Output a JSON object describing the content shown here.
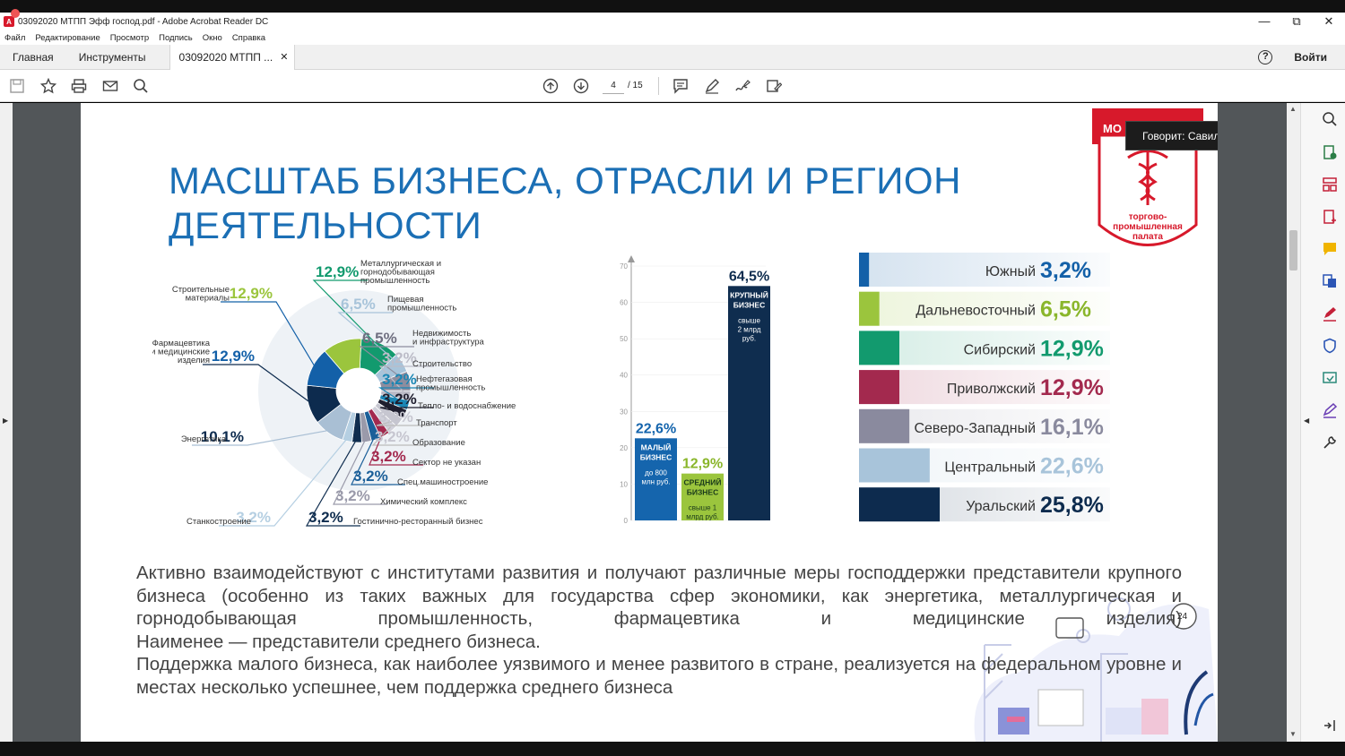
{
  "window": {
    "title": "03092020 МТПП Эфф господ.pdf - Adobe Acrobat Reader DC"
  },
  "menu": [
    "Файл",
    "Редактирование",
    "Просмотр",
    "Подпись",
    "Окно",
    "Справка"
  ],
  "tabs": {
    "home": "Главная",
    "tools": "Инструменты",
    "document": "03092020 МТПП ...",
    "login": "Войти"
  },
  "toolbar": {
    "current_page": "4",
    "total_pages": "/ 15"
  },
  "speaker": "Говорит: Савилия Дорогова",
  "logo": {
    "text_top": "МО",
    "text_bottom": "торгово-промышленная палата",
    "lines": [
      "торгово-",
      "промышленная",
      "палата"
    ]
  },
  "slide": {
    "title_line1": "МАСШТАБ БИЗНЕСА, ОТРАСЛИ И РЕГИОН",
    "title_line2": "ДЕЯТЕЛЬНОСТИ",
    "paragraph1": "Активно взаимодействуют с институтами развития и получают различные меры господдержки представители крупного бизнеса (особенно из таких важных для государства сфер экономики, как энергетика, металлургическая и горнодобывающая промышленность, фармацевтика и медицинские изделия)",
    "paragraph2": "Наименее — представители среднего бизнеса.",
    "paragraph3": "Поддержка малого бизнеса, как наиболее уязвимого и менее развитого в стране, реализуется на федеральном уровне и местах несколько успешнее, чем поддержка среднего бизнеса",
    "badge_24": "24"
  },
  "chart_data": [
    {
      "type": "pie",
      "segments": [
        {
          "label": "Металлургическая и горнодобывающая промышленность",
          "value": 12.9,
          "display": "12,9%",
          "color": "#129a6e"
        },
        {
          "label": "Пищевая промышленность",
          "value": 6.5,
          "display": "6,5%",
          "color": "#a8c4da"
        },
        {
          "label": "Недвижимость и инфраструктура",
          "value": 6.5,
          "display": "6,5%",
          "color": "#8d8d9e"
        },
        {
          "label": "Строительство",
          "value": 3.2,
          "display": "3,2%",
          "color": "#bcbcc8"
        },
        {
          "label": "Нефтегазовая промышленность",
          "value": 3.2,
          "display": "3,2%",
          "color": "#1a86b4"
        },
        {
          "label": "Тепло- и водоснабжение",
          "value": 3.2,
          "display": "3,2%",
          "color": "#1e1e2e"
        },
        {
          "label": "Транспорт",
          "value": 3.2,
          "display": "3,2%",
          "color": "#c6c6d0"
        },
        {
          "label": "Образование",
          "value": 3.2,
          "display": "3,2%",
          "color": "#d0d0da"
        },
        {
          "label": "Сектор не указан",
          "value": 3.2,
          "display": "3,2%",
          "color": "#a3294e"
        },
        {
          "label": "Спец.машиностроение",
          "value": 3.2,
          "display": "3,2%",
          "color": "#1b5f99"
        },
        {
          "label": "Химический комплекс",
          "value": 3.2,
          "display": "3,2%",
          "color": "#9a9aaa"
        },
        {
          "label": "Гостинично-ресторанный бизнес",
          "value": 3.2,
          "display": "3,2%",
          "color": "#0f2d4f"
        },
        {
          "label": "Станкостроение",
          "value": 3.2,
          "display": "3,2%",
          "color": "#b5cfe2"
        },
        {
          "label": "Энергетика",
          "value": 10.1,
          "display": "10,1%",
          "color": "#a9bfd4"
        },
        {
          "label": "Фармацевтика и медицинские изделия",
          "value": 12.9,
          "display": "12,9%",
          "color": "#0d2b4e"
        },
        {
          "label": "Строительные материалы",
          "value": 12.9,
          "display": "12,9%",
          "color": "#1360a8"
        },
        {
          "label": "",
          "value": 12.9,
          "display": "",
          "color": "#9bc53d"
        }
      ],
      "labels": {
        "metal": [
          "Металлургическая и",
          "горнодобывающая",
          "промышленность"
        ],
        "food": [
          "Пищевая",
          "промышленность"
        ],
        "realty": [
          "Недвижимость",
          "и инфраструктура"
        ],
        "construction": "Строительство",
        "oilgas": [
          "Нефтегазовая",
          "промышленность"
        ],
        "heat": "Тепло- и водоснабжение",
        "transport": "Транспорт",
        "education": "Образование",
        "unknown": "Сектор не указан",
        "specmash": "Спец.машиностроение",
        "chem": "Химический комплекс",
        "hotel": "Гостинично-ресторанный бизнес",
        "machine": "Станкостроение",
        "energy": "Энергетика",
        "pharma": [
          "Фармацевтика",
          "и медицинские",
          "изделия"
        ],
        "buildmat": [
          "Строительные",
          "материалы"
        ]
      }
    },
    {
      "type": "bar",
      "categories": [
        "МАЛЫЙ БИЗНЕС",
        "СРЕДНИЙ БИЗНЕС",
        "КРУПНЫЙ БИЗНЕС"
      ],
      "values": [
        22.6,
        12.9,
        64.5
      ],
      "value_labels": [
        "22,6%",
        "12,9%",
        "64,5%"
      ],
      "sublabels": [
        [
          "до 800",
          "млн руб."
        ],
        [
          "свыше 1",
          "млрд руб."
        ],
        [
          "свыше",
          "2 млрд",
          "руб."
        ]
      ],
      "names": [
        [
          "МАЛЫЙ",
          "БИЗНЕС"
        ],
        [
          "СРЕДНИЙ",
          "БИЗНЕС"
        ],
        [
          "КРУПНЫЙ",
          "БИЗНЕС"
        ]
      ],
      "colors": [
        "#1565ad",
        "#9bc53d",
        "#0f2d4f"
      ],
      "value_colors": [
        "#1565ad",
        "#8ab62b",
        "#0f2d4f"
      ],
      "ylim": [
        0,
        70
      ],
      "yticks": [
        0,
        10,
        20,
        30,
        40,
        50,
        60,
        70
      ]
    },
    {
      "type": "bar",
      "orientation": "horizontal",
      "categories": [
        "Южный",
        "Дальневосточный",
        "Сибирский",
        "Приволжский",
        "Северо-Западный",
        "Центральный",
        "Уральский"
      ],
      "values": [
        3.2,
        6.5,
        12.9,
        12.9,
        16.1,
        22.6,
        25.8
      ],
      "value_labels": [
        "3,2%",
        "6,5%",
        "12,9%",
        "12,9%",
        "16,1%",
        "22,6%",
        "25,8%"
      ],
      "colors": [
        "#1360a8",
        "#9bc53d",
        "#129a6e",
        "#a3294e",
        "#8a8a9e",
        "#a8c4da",
        "#0d2b4e"
      ],
      "value_colors": [
        "#1360a8",
        "#8ab62b",
        "#129a6e",
        "#a3294e",
        "#8a8a9e",
        "#a8c4da",
        "#0d2b4e"
      ]
    }
  ]
}
